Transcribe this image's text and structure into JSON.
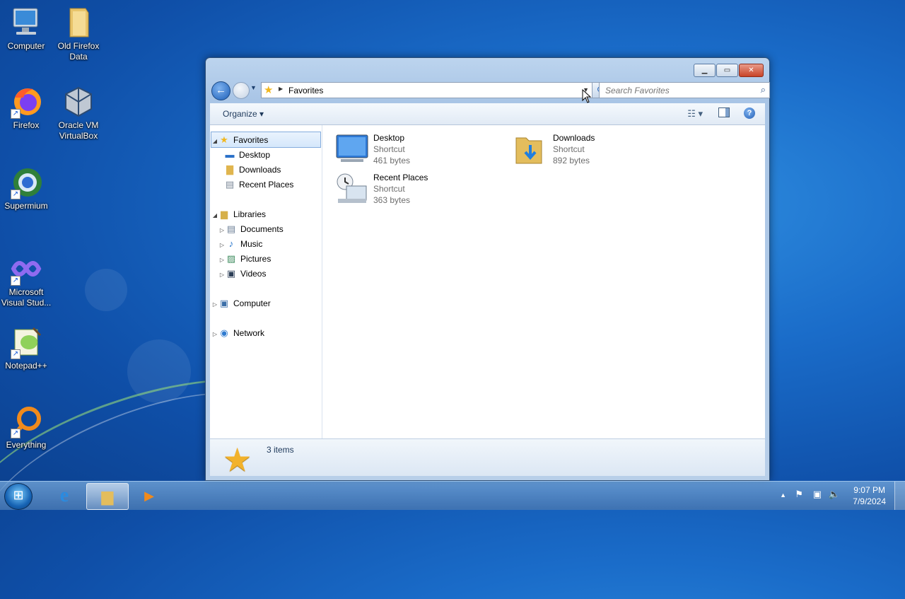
{
  "desktop": {
    "icons": [
      {
        "label": "Computer",
        "icon": "computer-icon"
      },
      {
        "label": "Old Firefox Data",
        "icon": "folder-icon"
      },
      {
        "label": "Firefox",
        "icon": "firefox-icon"
      },
      {
        "label": "Oracle VM VirtualBox",
        "icon": "virtualbox-icon"
      },
      {
        "label": "Supermium",
        "icon": "supermium-icon"
      },
      {
        "label": "Microsoft Visual Stud...",
        "icon": "visual-studio-icon"
      },
      {
        "label": "Notepad++",
        "icon": "notepadpp-icon"
      },
      {
        "label": "Everything",
        "icon": "everything-icon"
      }
    ]
  },
  "window": {
    "address": {
      "crumb": "Favorites"
    },
    "search": {
      "placeholder": "Search Favorites"
    },
    "toolbar": {
      "organize_label": "Organize"
    },
    "nav": {
      "favorites": "Favorites",
      "desktop": "Desktop",
      "downloads": "Downloads",
      "recent": "Recent Places",
      "libraries": "Libraries",
      "documents": "Documents",
      "music": "Music",
      "pictures": "Pictures",
      "videos": "Videos",
      "computer": "Computer",
      "network": "Network"
    },
    "files": [
      {
        "name": "Desktop",
        "type": "Shortcut",
        "size": "461 bytes"
      },
      {
        "name": "Downloads",
        "type": "Shortcut",
        "size": "892 bytes"
      },
      {
        "name": "Recent Places",
        "type": "Shortcut",
        "size": "363 bytes"
      }
    ],
    "details": {
      "count": "3 items"
    }
  },
  "taskbar": {
    "time": "9:07 PM",
    "date": "7/9/2024"
  },
  "colors": {
    "accent": "#1d5fb8",
    "selection": "#d5e7fb"
  }
}
